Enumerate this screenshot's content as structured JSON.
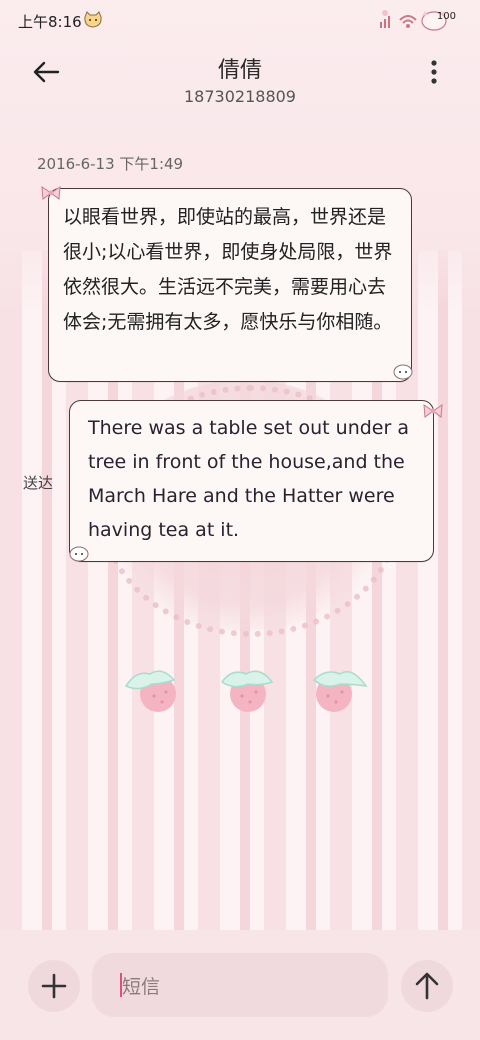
{
  "status_bar": {
    "time": "上午8:16",
    "battery": "100"
  },
  "header": {
    "contact_name": "倩倩",
    "contact_number": "18730218809"
  },
  "conversation": {
    "timestamp": "2016-6-13 下午1:49",
    "messages": [
      {
        "direction": "incoming",
        "text": "以眼看世界，即使站的最高，世界还是很小;以心看世界，即使身处局限，世界依然很大。生活远不完美，需要用心去体会;无需拥有太多，愿快乐与你相随。"
      },
      {
        "direction": "outgoing",
        "text": "There was a table set out under a tree in front of the house,and the March Hare and the Hatter were having tea at it.",
        "status": "送达"
      }
    ]
  },
  "composer": {
    "placeholder": "短信",
    "add_icon": "plus-icon",
    "send_icon": "arrow-up-icon"
  },
  "colors": {
    "accent_cursor": "#e0507a",
    "bubble_border": "#4a3a3a",
    "bubble_fill": "#fdf7f6",
    "background": "#f8e6e8"
  }
}
